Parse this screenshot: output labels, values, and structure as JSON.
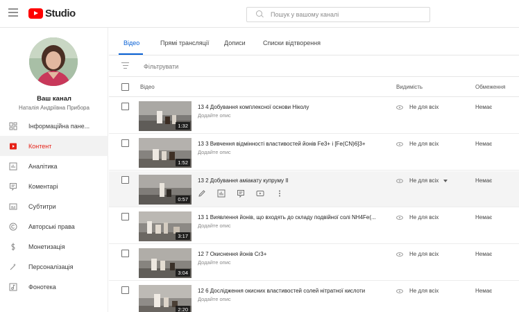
{
  "app": {
    "logo_text": "Studio"
  },
  "search": {
    "placeholder": "Пошук у вашому каналі"
  },
  "channel": {
    "title": "Ваш канал",
    "owner": "Наталія Андріївна Прибора"
  },
  "sidebar": {
    "items": [
      {
        "label": "Інформаційна пане...",
        "icon": "dashboard-icon",
        "active": false
      },
      {
        "label": "Контент",
        "icon": "content-icon",
        "active": true
      },
      {
        "label": "Аналітика",
        "icon": "analytics-icon",
        "active": false
      },
      {
        "label": "Коментарі",
        "icon": "comments-icon",
        "active": false
      },
      {
        "label": "Субтитри",
        "icon": "subtitles-icon",
        "active": false
      },
      {
        "label": "Авторські права",
        "icon": "copyright-icon",
        "active": false
      },
      {
        "label": "Монетизація",
        "icon": "monetization-icon",
        "active": false
      },
      {
        "label": "Персоналізація",
        "icon": "customization-icon",
        "active": false
      },
      {
        "label": "Фонотека",
        "icon": "audio-library-icon",
        "active": false
      }
    ]
  },
  "tabs": [
    {
      "label": "Відео",
      "active": true
    },
    {
      "label": "Прямі трансляції",
      "active": false
    },
    {
      "label": "Дописи",
      "active": false
    },
    {
      "label": "Списки відтворення",
      "active": false
    }
  ],
  "filter": {
    "label": "Фільтрувати"
  },
  "table": {
    "headers": {
      "video": "Відео",
      "visibility": "Видимість",
      "restrictions": "Обмеження"
    },
    "rows": [
      {
        "title": "13 4 Добування комплексної основи Ніколу",
        "desc": "Додайте опис",
        "duration": "1:32",
        "visibility": "Не для всіх",
        "restrictions": "Немає"
      },
      {
        "title": "13 3 Вивчення відмінності властивостей йонів Fe3+ і [Fe(CN)6]3+",
        "desc": "Додайте опис",
        "duration": "1:52",
        "visibility": "Не для всіх",
        "restrictions": "Немає"
      },
      {
        "title": "13 2 Добування аміакату купруму ІІ",
        "desc": "",
        "duration": "0:57",
        "visibility": "Не для всіх",
        "restrictions": "Немає",
        "hover": true
      },
      {
        "title": "13 1 Виявлення йонів, що входять до складу подвійної солі NH4Fe(...",
        "desc": "Додайте опис",
        "duration": "3:17",
        "visibility": "Не для всіх",
        "restrictions": "Немає"
      },
      {
        "title": "12 7 Окиснення йонів Cr3+",
        "desc": "Додайте опис",
        "duration": "3:04",
        "visibility": "Не для всіх",
        "restrictions": "Немає"
      },
      {
        "title": "12 6 Дослідження окисних властивостей солей нітратної кислоти",
        "desc": "Додайте опис",
        "duration": "2:20",
        "visibility": "Не для всіх",
        "restrictions": "Немає"
      }
    ]
  },
  "colors": {
    "accent": "#065fd4",
    "active_nav": "#e62117",
    "logo_red": "#ff0000"
  }
}
